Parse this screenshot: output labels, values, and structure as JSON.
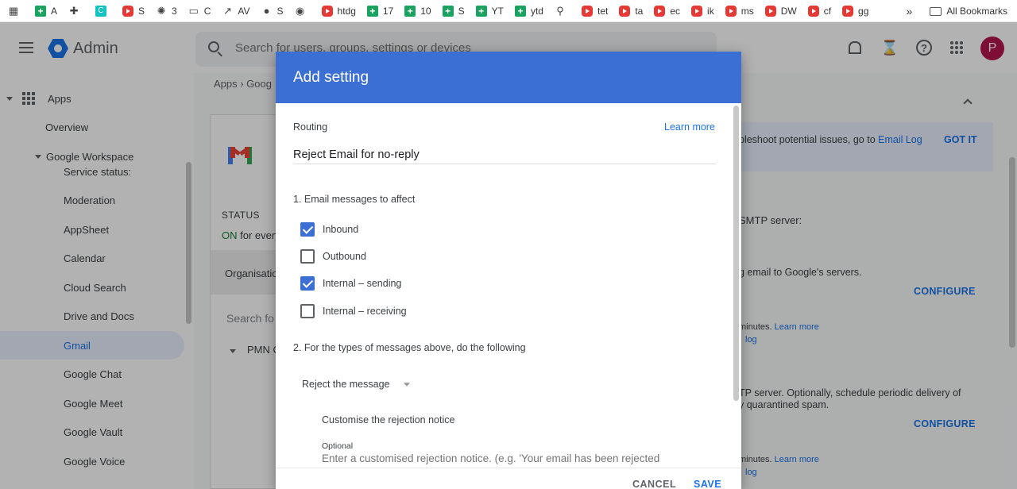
{
  "bookmarks": [
    {
      "label": "",
      "icon": "app-grid-icon",
      "kind": "plain"
    },
    {
      "label": "A",
      "icon": "sheets-icon",
      "kind": "green"
    },
    {
      "label": "",
      "icon": "puzzle-icon",
      "kind": "plain"
    },
    {
      "label": "",
      "icon": "canva-icon",
      "kind": "teal"
    },
    {
      "label": "S",
      "icon": "youtube-icon",
      "kind": "red"
    },
    {
      "label": "3",
      "icon": "openai-icon",
      "kind": "plain"
    },
    {
      "label": "C",
      "icon": "folder-icon",
      "kind": "plain"
    },
    {
      "label": "AV",
      "icon": "trend-icon",
      "kind": "plain"
    },
    {
      "label": "S",
      "icon": "globe-icon",
      "kind": "plain"
    },
    {
      "label": "",
      "icon": "github-icon",
      "kind": "plain"
    },
    {
      "label": "htdg",
      "icon": "youtube-icon",
      "kind": "red"
    },
    {
      "label": "17",
      "icon": "sheets-icon",
      "kind": "green"
    },
    {
      "label": "10",
      "icon": "sheets-icon",
      "kind": "green"
    },
    {
      "label": "S",
      "icon": "sheets-icon",
      "kind": "green"
    },
    {
      "label": "YT",
      "icon": "sheets-icon",
      "kind": "green"
    },
    {
      "label": "ytd",
      "icon": "sheets-icon",
      "kind": "green"
    },
    {
      "label": "",
      "icon": "pin-icon",
      "kind": "plain"
    },
    {
      "label": "tet",
      "icon": "youtube-icon",
      "kind": "red"
    },
    {
      "label": "ta",
      "icon": "youtube-icon",
      "kind": "red"
    },
    {
      "label": "ec",
      "icon": "youtube-icon",
      "kind": "red"
    },
    {
      "label": "ik",
      "icon": "youtube-icon",
      "kind": "red"
    },
    {
      "label": "ms",
      "icon": "youtube-icon",
      "kind": "red"
    },
    {
      "label": "DW",
      "icon": "youtube-icon",
      "kind": "red"
    },
    {
      "label": "cf",
      "icon": "youtube-icon",
      "kind": "red"
    },
    {
      "label": "gg",
      "icon": "youtube-icon",
      "kind": "red"
    }
  ],
  "bookmarks_more": "»",
  "all_bookmarks": "All Bookmarks",
  "header": {
    "brand": "Admin",
    "search_placeholder": "Search for users, groups, settings or devices",
    "avatar_letter": "P"
  },
  "sidebar": {
    "apps": "Apps",
    "overview": "Overview",
    "workspace": "Google Workspace",
    "items": [
      "Service status:",
      "Moderation",
      "AppSheet",
      "Calendar",
      "Cloud Search",
      "Drive and Docs",
      "Gmail",
      "Google Chat",
      "Google Meet",
      "Google Vault",
      "Google Voice"
    ]
  },
  "main": {
    "breadcrumb": "Apps  ›  Goog",
    "status_title": "STATUS",
    "status_on": "ON",
    "status_rest": " for every",
    "org_row": "Organisatio",
    "card_search": "Search fo",
    "ou": "PMN C",
    "info_text": "bleshoot potential issues, go to ",
    "info_link": "Email Log",
    "got_it": "GOT IT",
    "smtp_server": "SMTP server:",
    "email_google": "g email to Google's servers.",
    "configure": "CONFIGURE",
    "minutes": "minutes. ",
    "learn_more": "Learn more",
    "log": "log",
    "tp_server": "TP server. Optionally, schedule periodic delivery of",
    "quarantined": "y quarantined spam."
  },
  "dialog": {
    "title": "Add setting",
    "section": "Routing",
    "learn_more": "Learn more",
    "description_value": "Reject Email for no-reply",
    "step1": "1. Email messages to affect",
    "checkboxes": [
      {
        "label": "Inbound",
        "checked": true
      },
      {
        "label": "Outbound",
        "checked": false
      },
      {
        "label": "Internal – sending",
        "checked": true
      },
      {
        "label": "Internal – receiving",
        "checked": false
      }
    ],
    "step2": "2. For the types of messages above, do the following",
    "action_selected": "Reject the message",
    "customise_label": "Customise the rejection notice",
    "optional_label": "Optional",
    "notice_placeholder": "Enter a customised rejection notice. (e.g. 'Your email has been rejected",
    "cancel": "CANCEL",
    "save": "SAVE"
  },
  "colors": {
    "accent": "#1a73e8",
    "dialog_header": "#3b6fd4",
    "status_on": "#188038",
    "avatar": "#b3164f"
  }
}
